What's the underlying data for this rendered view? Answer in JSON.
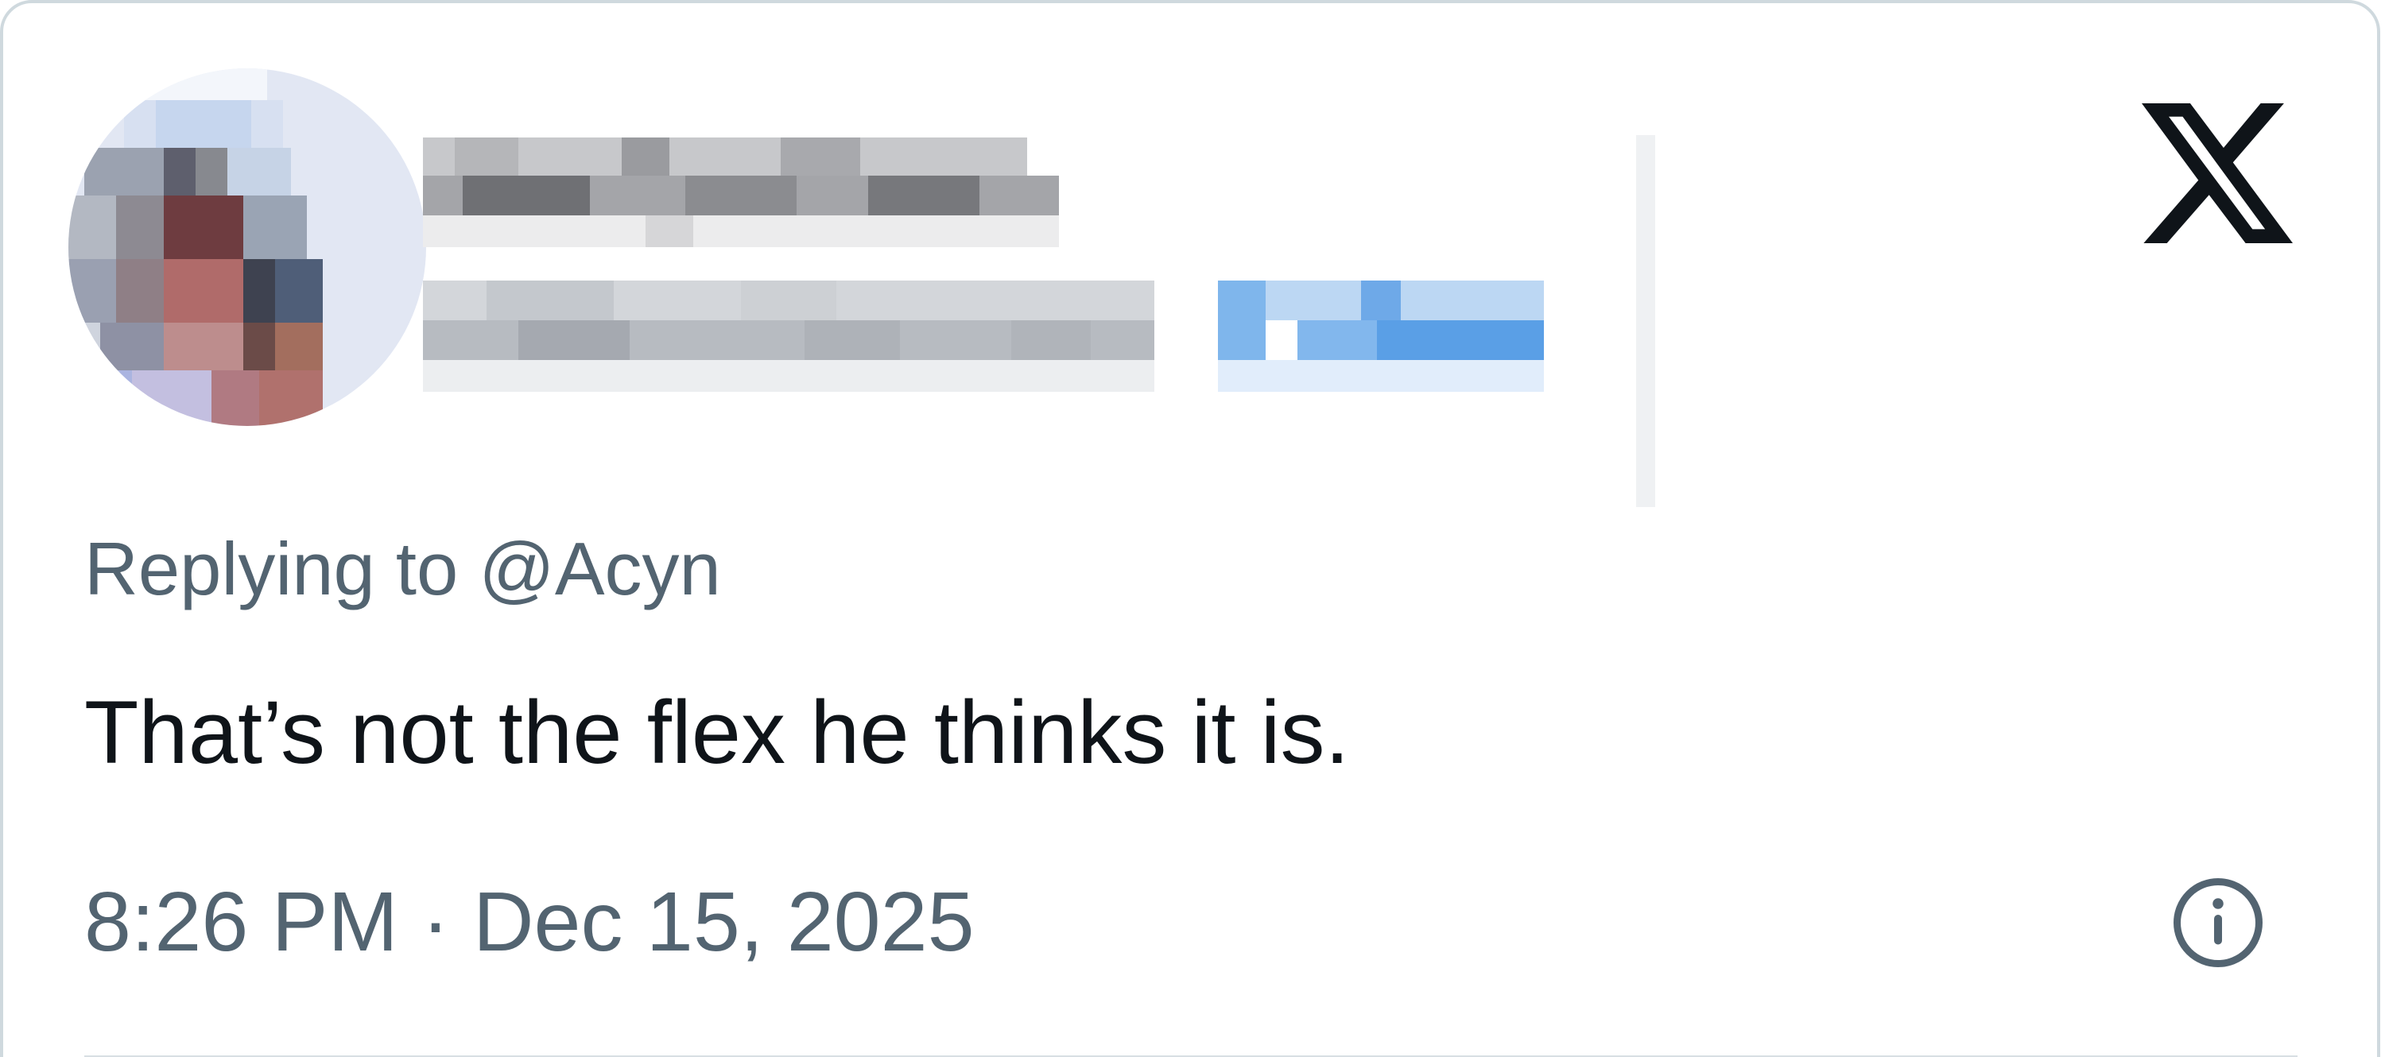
{
  "reply": {
    "text": "Replying to @Acyn"
  },
  "tweet": {
    "text": "That’s not the flex he thinks it is."
  },
  "meta": {
    "timestamp": "8:26 PM · Dec 15, 2025"
  },
  "icons": {
    "brand": "x-logo-icon",
    "info": "info-icon"
  },
  "colors": {
    "text_primary": "#0f1419",
    "text_secondary": "#536471",
    "border": "#cfd9de",
    "accent": "#1d9bf0"
  }
}
